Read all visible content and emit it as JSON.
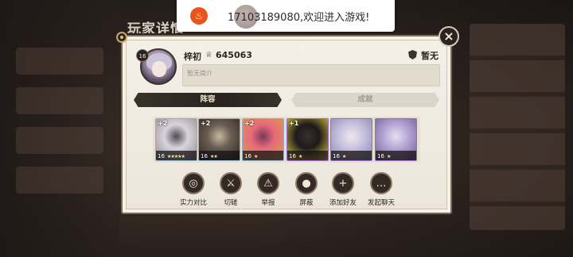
{
  "background": {
    "title": "玩家详情"
  },
  "notification": {
    "message": "17103189080,欢迎进入游戏!",
    "app_icon": "flame-app-icon",
    "badge_text": "",
    "tag_text": ""
  },
  "player": {
    "level": "16",
    "name": "梓初",
    "id": "645063",
    "guild": "暂无",
    "intro_placeholder": "暂无简介"
  },
  "tabs": [
    {
      "label": "阵容",
      "active": true
    },
    {
      "label": "成就",
      "active": false
    }
  ],
  "lineup": [
    {
      "plus": "+2",
      "level": "16",
      "stars": "★★★★★",
      "palette": [
        "#d9d4dc",
        "#8e8890",
        "#4e4a56"
      ]
    },
    {
      "plus": "+2",
      "level": "16",
      "stars": "★★",
      "palette": [
        "#6a5e52",
        "#2e2824",
        "#c8b8a0"
      ]
    },
    {
      "plus": "+2",
      "level": "16",
      "stars": "★",
      "palette": [
        "#e86a7a",
        "#d8a24a",
        "#7a3a5a"
      ]
    },
    {
      "plus": "+1",
      "level": "16",
      "stars": "★",
      "palette": [
        "#1e1a1c",
        "#e8d23a",
        "#3a302c"
      ]
    },
    {
      "plus": "",
      "level": "16",
      "stars": "★",
      "palette": [
        "#c9c4e0",
        "#8a84b0",
        "#f0e8ec"
      ]
    },
    {
      "plus": "",
      "level": "16",
      "stars": "★",
      "palette": [
        "#b8a8d8",
        "#6c5a8c",
        "#e8dff0"
      ]
    }
  ],
  "actions": [
    {
      "label": "实力对比",
      "icon": "compare-icon",
      "glyph": "◎"
    },
    {
      "label": "切磋",
      "icon": "swords-icon",
      "glyph": "⚔"
    },
    {
      "label": "举报",
      "icon": "warning-icon",
      "glyph": "⚠"
    },
    {
      "label": "屏蔽",
      "icon": "block-user-icon",
      "glyph": "●"
    },
    {
      "label": "添加好友",
      "icon": "add-friend-icon",
      "glyph": "+"
    },
    {
      "label": "发起聊天",
      "icon": "chat-icon",
      "glyph": "…"
    }
  ]
}
